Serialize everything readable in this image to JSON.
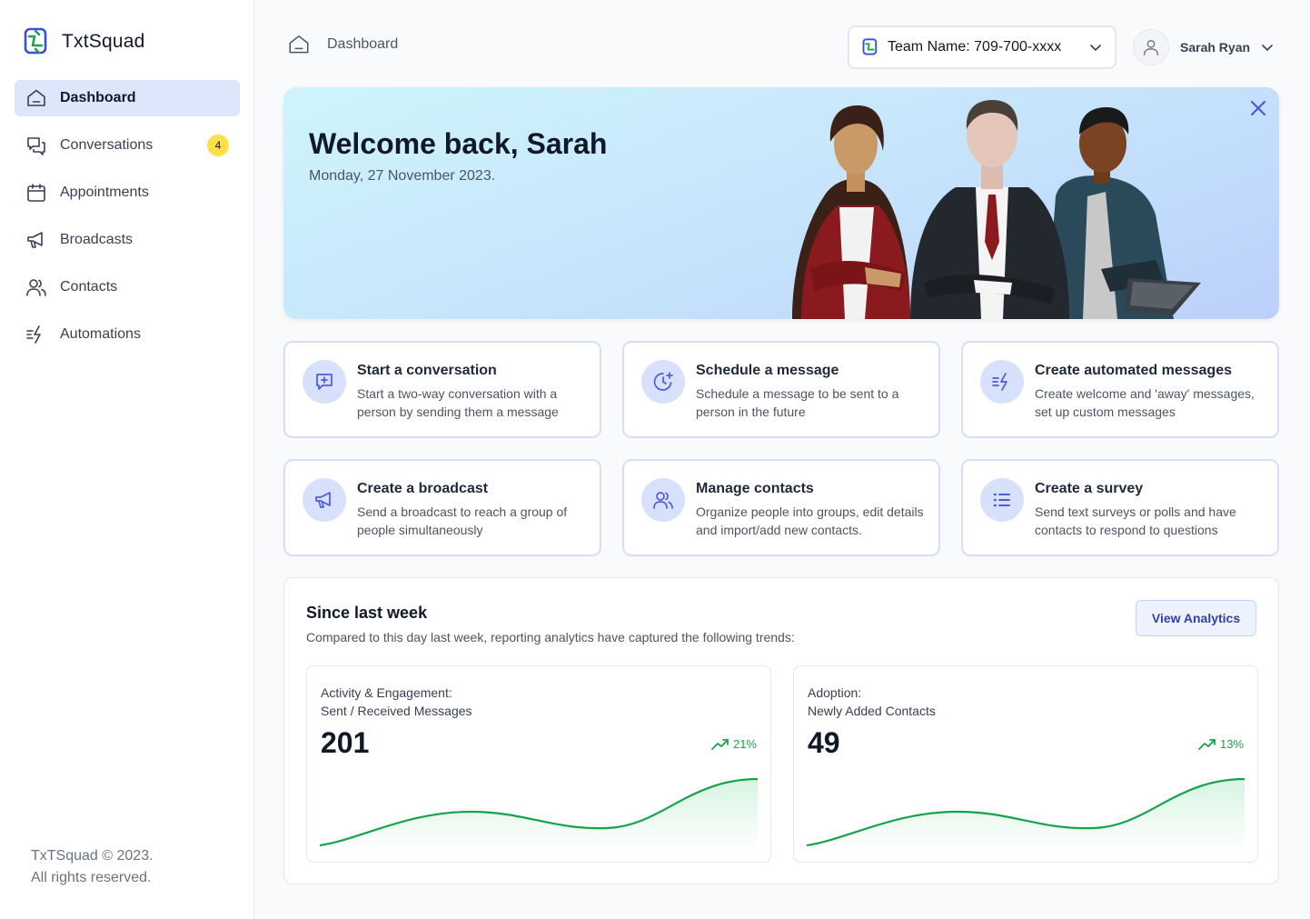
{
  "brand": {
    "name": "TxtSquad"
  },
  "sidebar": {
    "items": [
      {
        "label": "Dashboard",
        "icon": "home-icon",
        "active": true
      },
      {
        "label": "Conversations",
        "icon": "chat-bubbles-icon",
        "badge": "4"
      },
      {
        "label": "Appointments",
        "icon": "calendar-icon"
      },
      {
        "label": "Broadcasts",
        "icon": "megaphone-icon"
      },
      {
        "label": "Contacts",
        "icon": "users-icon"
      },
      {
        "label": "Automations",
        "icon": "lightning-icon"
      }
    ],
    "footer_line1": "TxTSquad © 2023.",
    "footer_line2": "All rights reserved."
  },
  "header": {
    "breadcrumb": "Dashboard",
    "team_select": "Team Name: 709-700-xxxx",
    "user_name": "Sarah Ryan"
  },
  "hero": {
    "title": "Welcome back, Sarah",
    "date": "Monday, 27 November 2023."
  },
  "actions": [
    {
      "title": "Start a conversation",
      "desc": "Start a two-way conversation with a person by sending them a message",
      "icon": "chat-plus-icon"
    },
    {
      "title": "Schedule a message",
      "desc": "Schedule a message to be sent to a person in the future",
      "icon": "clock-plus-icon"
    },
    {
      "title": "Create automated messages",
      "desc": "Create welcome and 'away' messages, set up custom messages",
      "icon": "lightning-icon"
    },
    {
      "title": "Create a broadcast",
      "desc": "Send a broadcast to reach a group of people simultaneously",
      "icon": "megaphone-icon"
    },
    {
      "title": "Manage contacts",
      "desc": "Organize people into groups, edit details and import/add new contacts.",
      "icon": "users-icon"
    },
    {
      "title": "Create a survey",
      "desc": "Send text surveys or polls and have contacts to respond to questions",
      "icon": "list-icon"
    }
  ],
  "stats": {
    "title": "Since last week",
    "subtitle": "Compared to this day last week, reporting analytics have captured the following trends:",
    "button": "View Analytics",
    "metrics": [
      {
        "line1": "Activity & Engagement:",
        "line2": "Sent / Received Messages",
        "value": "201",
        "trend": "21%"
      },
      {
        "line1": "Adoption:",
        "line2": "Newly Added Contacts",
        "value": "49",
        "trend": "13%"
      }
    ]
  },
  "colors": {
    "accent": "#4f5bd5",
    "active_bg": "#dde7fb",
    "trend_green": "#16a34a",
    "badge": "#fde047"
  }
}
